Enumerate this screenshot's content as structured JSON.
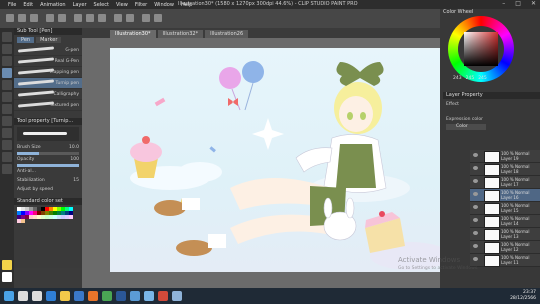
{
  "menu": [
    "File",
    "Edit",
    "Animation",
    "Layer",
    "Select",
    "View",
    "Filter",
    "Window",
    "Help"
  ],
  "title": "Illustration30* (1580 x 1270px 300dpi 44.6%) - CLIP STUDIO PAINT PRO",
  "tabs": [
    "Illustration30*",
    "Illustration32*",
    "Illustration26"
  ],
  "subtool": {
    "header": "Sub Tool [Pen]",
    "groups": [
      "Pen",
      "Marker"
    ],
    "brushes": [
      "G-pen",
      "Real G-Pen",
      "Mapping pen",
      "Turnip pen",
      "Calligraphy",
      "Textured pen"
    ],
    "selected_index": 3
  },
  "toolprop": {
    "header": "Tool property [Turnip...",
    "brush_size_label": "Brush Size",
    "brush_size": "10.0",
    "opacity_label": "Opacity",
    "opacity": "100",
    "anti_label": "Anti-al...",
    "stab_label": "Stabilization",
    "stab": "15",
    "adjust": "Adjust by speed"
  },
  "colorset": {
    "header": "Standard color set",
    "colors": [
      "#ffffff",
      "#e6e6e6",
      "#cccccc",
      "#999999",
      "#666666",
      "#333333",
      "#000000",
      "#ff0000",
      "#ff8000",
      "#ffff00",
      "#80ff00",
      "#00ff00",
      "#00ff80",
      "#00ffff",
      "#0080ff",
      "#0000ff",
      "#8000ff",
      "#ff00ff",
      "#ff0080",
      "#800000",
      "#804000",
      "#808000",
      "#408000",
      "#008000",
      "#008040",
      "#008080",
      "#004080",
      "#000080",
      "#400080",
      "#800080",
      "#800040",
      "#ffcccc",
      "#ffe0cc",
      "#ffffcc",
      "#e0ffcc",
      "#ccffcc",
      "#ccffe0",
      "#ccffff",
      "#cce0ff",
      "#ccccff",
      "#e0ccff",
      "#ffccff",
      "#ffcce0",
      "#f4c28c"
    ]
  },
  "right": {
    "color_wheel_header": "Color Wheel",
    "rgb": [
      "243",
      "245",
      "245"
    ],
    "layer_property_header": "Layer Property",
    "effect_label": "Effect",
    "expression_label": "Expression color",
    "expression_value": "Color"
  },
  "layers": [
    {
      "name": "100 % Normal",
      "sub": "Layer 19"
    },
    {
      "name": "100 % Normal",
      "sub": "Layer 18"
    },
    {
      "name": "100 % Normal",
      "sub": "Layer 17"
    },
    {
      "name": "100 % Normal",
      "sub": "Layer 16"
    },
    {
      "name": "100 % Normal",
      "sub": "Layer 15"
    },
    {
      "name": "100 % Normal",
      "sub": "Layer 14"
    },
    {
      "name": "100 % Normal",
      "sub": "Layer 13"
    },
    {
      "name": "100 % Normal",
      "sub": "Layer 12"
    },
    {
      "name": "100 % Normal",
      "sub": "Layer 11"
    }
  ],
  "selected_layer": 3,
  "watermark": {
    "line1": "Activate Windows",
    "line2": "Go to Settings to activate Windows."
  },
  "clock": {
    "time": "23:37",
    "date": "28/12/2566"
  },
  "taskbar_icons": [
    "start-icon",
    "search-icon",
    "taskview-icon",
    "edge-icon",
    "explorer-icon",
    "store-icon",
    "firefox-icon",
    "chrome-icon",
    "word-icon",
    "photos-icon",
    "clipstudio-icon",
    "media-icon",
    "clipstudio2-icon"
  ]
}
